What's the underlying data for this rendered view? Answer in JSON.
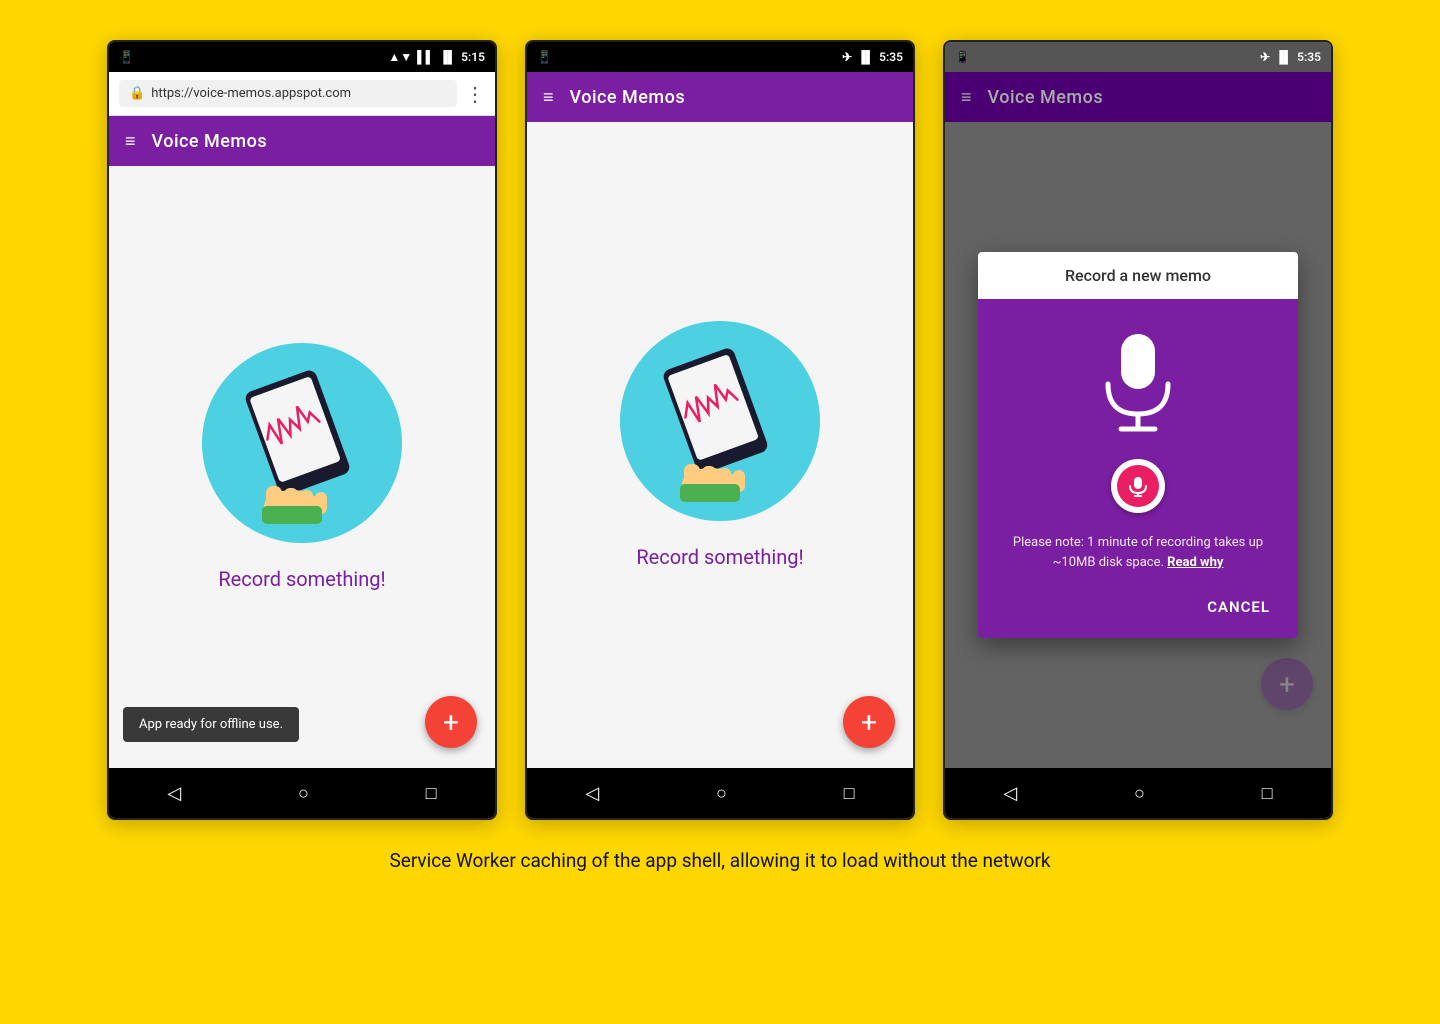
{
  "background_color": "#FFD700",
  "caption": "Service Worker caching of the app shell, allowing it to load without the network",
  "phone1": {
    "status_bar": {
      "phone_icon": "📱",
      "wifi": "▲",
      "signal": "▌▌",
      "battery": "🔋",
      "time": "5:15"
    },
    "url_bar": {
      "url": "https://voice-memos.appspot.com",
      "menu_icon": "⋮"
    },
    "app_bar": {
      "menu_icon": "≡",
      "title": "Voice Memos"
    },
    "content": {
      "record_label": "Record something!"
    },
    "toast": "App ready for offline use.",
    "fab_label": "+"
  },
  "phone2": {
    "status_bar": {
      "phone_icon": "📱",
      "airplane": "✈",
      "battery": "🔋",
      "time": "5:35"
    },
    "app_bar": {
      "menu_icon": "≡",
      "title": "Voice Memos"
    },
    "content": {
      "record_label": "Record something!"
    },
    "fab_label": "+"
  },
  "phone3": {
    "status_bar": {
      "phone_icon": "📱",
      "airplane": "✈",
      "battery": "🔋",
      "time": "5:35"
    },
    "app_bar": {
      "menu_icon": "≡",
      "title": "Voice Memos"
    },
    "dialog": {
      "title": "Record a new memo",
      "note": "Please note: 1 minute of recording takes up ~10MB disk space.",
      "note_link": "Read why",
      "cancel_label": "CANCEL"
    },
    "fab_label": "+"
  },
  "nav_buttons": {
    "back": "◁",
    "home": "○",
    "recents": "□"
  }
}
